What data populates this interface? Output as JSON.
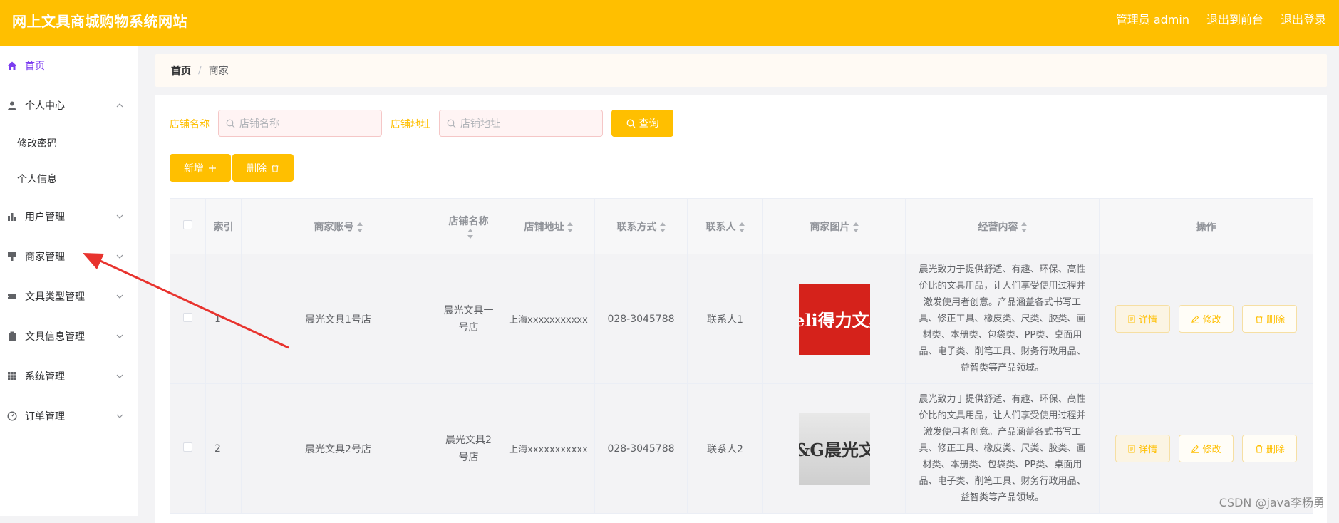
{
  "header": {
    "title": "网上文具商城购物系统网站",
    "admin_label": "管理员 admin",
    "to_front": "退出到前台",
    "logout": "退出登录"
  },
  "sidebar": {
    "home": "首页",
    "personal_center": "个人中心",
    "change_password": "修改密码",
    "personal_info": "个人信息",
    "user_mgmt": "用户管理",
    "merchant_mgmt": "商家管理",
    "stationery_type_mgmt": "文具类型管理",
    "stationery_info_mgmt": "文具信息管理",
    "system_mgmt": "系统管理",
    "order_mgmt": "订单管理"
  },
  "breadcrumb": {
    "home": "首页",
    "separator": "/",
    "current": "商家"
  },
  "search": {
    "shop_name_label": "店铺名称",
    "shop_name_placeholder": "店铺名称",
    "shop_address_label": "店铺地址",
    "shop_address_placeholder": "店铺地址",
    "query_button": "查询"
  },
  "actions": {
    "add": "新增",
    "delete": "删除"
  },
  "table": {
    "headers": {
      "index": "索引",
      "account": "商家账号",
      "shop_name": "店铺名称",
      "shop_address": "店铺地址",
      "contact_method": "联系方式",
      "contact_person": "联系人",
      "image": "商家图片",
      "business": "经营内容",
      "operation": "操作"
    },
    "rows": [
      {
        "index": "1",
        "account": "晨光文具1号店",
        "shop_name": "晨光文具一号店",
        "shop_address": "上海xxxxxxxxxxx",
        "contact_method": "028-3045788",
        "contact_person": "联系人1",
        "image_text": "deli得力文具",
        "business": "晨光致力于提供舒适、有趣、环保、高性价比的文具用品，让人们享受使用过程并激发使用者创意。产品涵盖各式书写工具、修正工具、橡皮类、尺类、胶类、画材类、本册类、包袋类、PP类、桌面用品、电子类、削笔工具、财务行政用品、益智类等产品领域。"
      },
      {
        "index": "2",
        "account": "晨光文具2号店",
        "shop_name": "晨光文具2号店",
        "shop_address": "上海xxxxxxxxxxx",
        "contact_method": "028-3045788",
        "contact_person": "联系人2",
        "image_text": "M&G晨光文具",
        "business": "晨光致力于提供舒适、有趣、环保、高性价比的文具用品，让人们享受使用过程并激发使用者创意。产品涵盖各式书写工具、修正工具、橡皮类、尺类、胶类、画材类、本册类、包袋类、PP类、桌面用品、电子类、削笔工具、财务行政用品、益智类等产品领域。"
      }
    ],
    "op_detail": "详情",
    "op_edit": "修改",
    "op_delete": "删除"
  },
  "watermark": "CSDN @java李杨勇",
  "colors": {
    "accent": "#ffbf00",
    "active_menu": "#7b3cf0",
    "arrow": "#e8332e"
  }
}
